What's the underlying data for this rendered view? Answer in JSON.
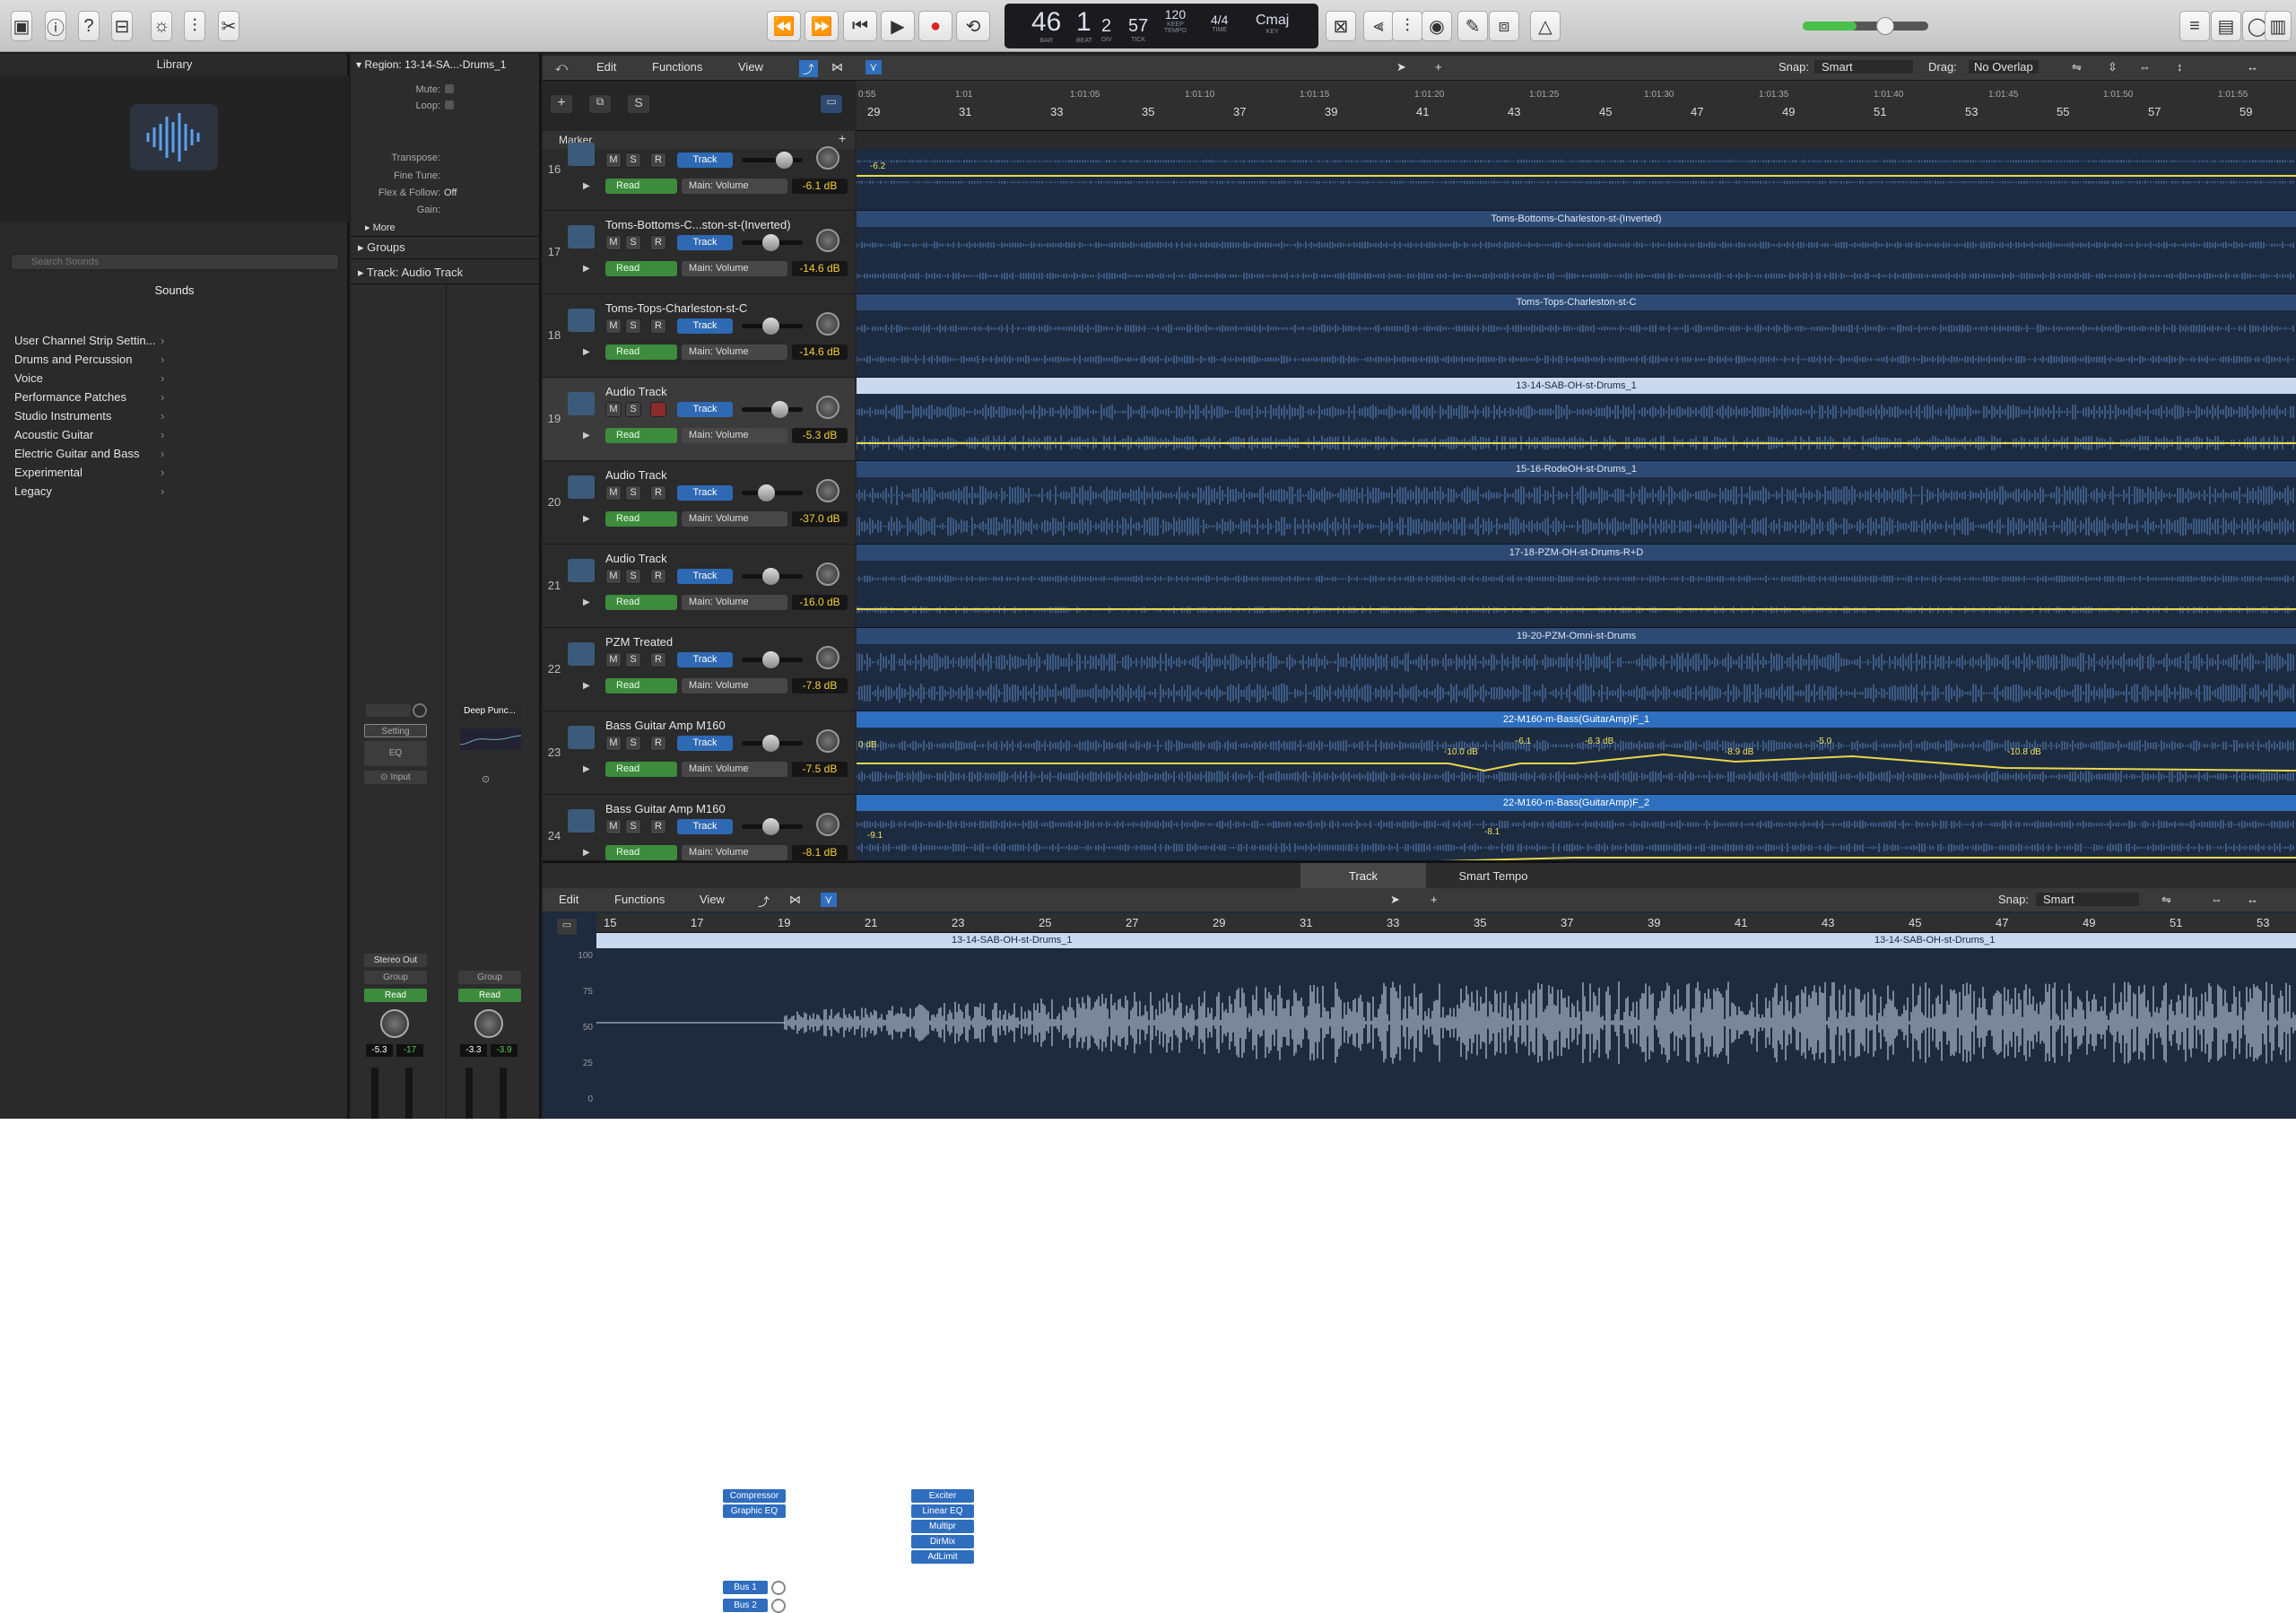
{
  "lcd": {
    "bar": "46",
    "beat": "1",
    "div": "2",
    "tick": "57",
    "tempo": "120",
    "tempo_keep": "KEEP",
    "sig": "4/4",
    "key": "Cmaj",
    "lbl_bar": "BAR",
    "lbl_beat": "BEAT",
    "lbl_div": "DIV",
    "lbl_tick": "TICK",
    "lbl_tempo": "TEMPO",
    "lbl_time": "TIME",
    "lbl_key": "KEY"
  },
  "library": {
    "title": "Library",
    "sounds": "Sounds",
    "search_placeholder": "Search Sounds",
    "items": [
      "User Channel Strip Settin...",
      "Drums and Percussion",
      "Voice",
      "Performance Patches",
      "Studio Instruments",
      "Acoustic Guitar",
      "Electric Guitar and Bass",
      "Experimental",
      "Legacy"
    ]
  },
  "inspector": {
    "region_label": "Region:",
    "region_name": "13-14-SA...-Drums_1",
    "mute": "Mute:",
    "loop": "Loop:",
    "transpose": "Transpose:",
    "fine_tune": "Fine Tune:",
    "flex": "Flex & Follow:",
    "flex_val": "Off",
    "gain": "Gain:",
    "more": "More",
    "groups": "Groups",
    "track_label": "Track:",
    "track_name": "Audio Track"
  },
  "strip1": {
    "setting": "Setting",
    "eq": "EQ",
    "input": "Input",
    "plugins": [
      "Compressor",
      "Graphic EQ"
    ],
    "sends": [
      "Bus 1",
      "Bus 2"
    ],
    "output": "Stereo Out",
    "group": "Group",
    "read": "Read",
    "vol": "-5.3",
    "pan": "-17"
  },
  "strip2": {
    "setting": "Deep Punc...",
    "plugins": [
      "Exciter",
      "Linear EQ",
      "Multipr",
      "DirMix",
      "AdLimit"
    ],
    "group": "Group",
    "read": "Read",
    "vol": "-3.3",
    "pan": "-3.9"
  },
  "tracks_header": {
    "edit": "Edit",
    "functions": "Functions",
    "view": "View",
    "snap_label": "Snap:",
    "snap_val": "Smart",
    "drag_label": "Drag:",
    "drag_val": "No Overlap",
    "marker": "Marker"
  },
  "tracks": [
    {
      "num": "16",
      "name": "",
      "db": "-6.1 dB",
      "sel": false
    },
    {
      "num": "17",
      "name": "Toms-Bottoms-C...ston-st-(Inverted)",
      "db": "-14.6 dB",
      "sel": false
    },
    {
      "num": "18",
      "name": "Toms-Tops-Charleston-st-C",
      "db": "-14.6 dB",
      "sel": false
    },
    {
      "num": "19",
      "name": "Audio Track",
      "db": "-5.3 dB",
      "sel": true
    },
    {
      "num": "20",
      "name": "Audio Track",
      "db": "-37.0 dB",
      "sel": false
    },
    {
      "num": "21",
      "name": "Audio Track",
      "db": "-16.0 dB",
      "sel": false
    },
    {
      "num": "22",
      "name": "PZM  Treated",
      "db": "-7.8 dB",
      "sel": false
    },
    {
      "num": "23",
      "name": "Bass Guitar Amp M160",
      "db": "-7.5 dB",
      "sel": false
    },
    {
      "num": "24",
      "name": "Bass Guitar Amp  M160",
      "db": "-8.1 dB",
      "sel": false
    }
  ],
  "track_labels": {
    "m": "M",
    "s": "S",
    "r": "R",
    "track": "Track",
    "read": "Read",
    "main_volume": "Main: Volume"
  },
  "regions": [
    {
      "name": "",
      "auto": "-6.2"
    },
    {
      "name": "Toms-Bottoms-Charleston-st-(Inverted)"
    },
    {
      "name": "Toms-Tops-Charleston-st-C"
    },
    {
      "name": "13-14-SAB-OH-st-Drums_1"
    },
    {
      "name": "15-16-RodeOH-st-Drums_1"
    },
    {
      "name": "17-18-PZM-OH-st-Drums-R+D"
    },
    {
      "name": "19-20-PZM-Omni-st-Drums"
    },
    {
      "name": "22-M160-m-Bass(GuitarAmp)F_1",
      "pts": [
        "0 dB",
        "-10.0 dB",
        "-6.1",
        "-6.3 dB",
        "-8.9 dB",
        "-5.0",
        "-10.8 dB"
      ]
    },
    {
      "name": "22-M160-m-Bass(GuitarAmp)F_2",
      "pts": [
        "-9.1",
        "-8.1"
      ]
    }
  ],
  "ruler_bars": [
    "29",
    "31",
    "33",
    "35",
    "37",
    "39",
    "41",
    "43",
    "45",
    "47",
    "49",
    "51",
    "53",
    "55",
    "57",
    "59"
  ],
  "ruler_times": [
    "0:55",
    "1:01",
    "1:01:05",
    "1:01:10",
    "1:01:15",
    "1:01:20",
    "1:01:25",
    "1:01:30",
    "1:01:35",
    "1:01:40",
    "1:01:45",
    "1:01:50",
    "1:01:55"
  ],
  "editor": {
    "tab_track": "Track",
    "tab_smart_tempo": "Smart Tempo",
    "edit": "Edit",
    "functions": "Functions",
    "view": "View",
    "snap_label": "Snap:",
    "snap_val": "Smart",
    "bars": [
      "15",
      "17",
      "19",
      "21",
      "23",
      "25",
      "27",
      "29",
      "31",
      "33",
      "35",
      "37",
      "39",
      "41",
      "43",
      "45",
      "47",
      "49",
      "51",
      "53"
    ],
    "region1": "13-14-SAB-OH-st-Drums_1",
    "region2": "13-14-SAB-OH-st-Drums_1",
    "yaxis": [
      "100",
      "75",
      "50",
      "25",
      "0"
    ]
  },
  "colors": {
    "accent": "#2e6fbf",
    "read": "#3d8b3d",
    "automation": "#e8d84a",
    "region_bg": "#1d2b40"
  }
}
